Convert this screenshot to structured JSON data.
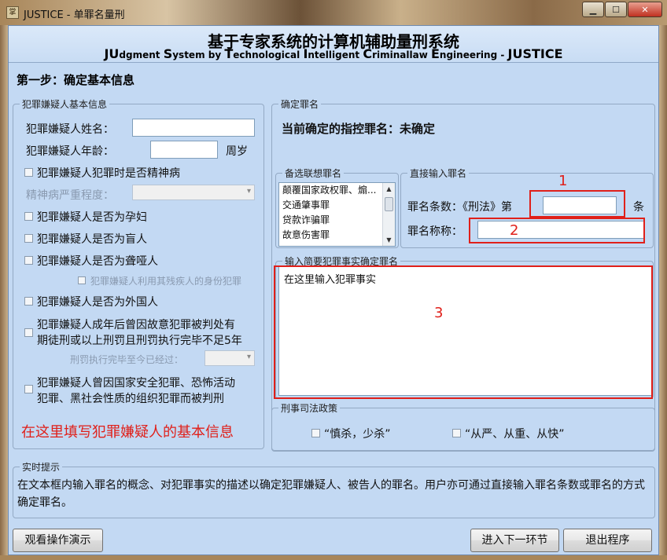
{
  "window": {
    "title": "JUSTICE - 单罪名量刑",
    "app_icon_text": "掌"
  },
  "header": {
    "main_title": "基于专家系统的计算机辅助量刑系统",
    "subtitle_parts": [
      {
        "cap": "JU",
        "rest": "dgment "
      },
      {
        "cap": "S",
        "rest": "ystem by "
      },
      {
        "cap": "T",
        "rest": "echnological "
      },
      {
        "cap": "I",
        "rest": "ntelligent "
      },
      {
        "cap": "C",
        "rest": "riminallaw "
      },
      {
        "cap": "E",
        "rest": "ngineering - "
      },
      {
        "cap": "JUSTICE",
        "rest": ""
      }
    ]
  },
  "step_title": "第一步：确定基本信息",
  "suspect_group": {
    "legend": "犯罪嫌疑人基本信息",
    "name_label": "犯罪嫌疑人姓名：",
    "name_value": "",
    "age_label": "犯罪嫌疑人年龄：",
    "age_value": "",
    "age_unit": "周岁",
    "mental_illness_label": "犯罪嫌疑人犯罪时是否精神病",
    "mental_severity_label": "精神病严重程度：",
    "mental_severity_value": "",
    "pregnant_label": "犯罪嫌疑人是否为孕妇",
    "blind_label": "犯罪嫌疑人是否为盲人",
    "deaf_label": "犯罪嫌疑人是否为聋哑人",
    "disabled_identity_label": "犯罪嫌疑人利用其残疾人的身份犯罪",
    "foreigner_label": "犯罪嫌疑人是否为外国人",
    "recidivist_label_line1": "犯罪嫌疑人成年后曾因故意犯罪被判处有",
    "recidivist_label_line2": "期徒刑或以上刑罚且刑罚执行完毕不足5年",
    "elapsed_label": "刑罚执行完毕至今已经过：",
    "elapsed_value": "",
    "special_label_line1": "犯罪嫌疑人曾因国家安全犯罪、恐怖活动",
    "special_label_line2": "犯罪、黑社会性质的组织犯罪而被判刑",
    "hint": "在这里填写犯罪嫌疑人的基本信息"
  },
  "charge_group": {
    "legend": "确定罪名",
    "current_charge_label": "当前确定的指控罪名：未确定",
    "suggest_legend": "备选联想罪名",
    "suggestions": [
      "颠覆国家政权罪、煽...",
      "交通肇事罪",
      "贷款诈骗罪",
      "故意伤害罪"
    ],
    "direct_legend": "直接输入罪名",
    "article_label": "罪名条数：《刑法》第",
    "article_value": "",
    "article_unit": "条",
    "charge_name_label": "罪名称称：",
    "charge_name_value": "",
    "annotations": [
      "1",
      "2",
      "3"
    ],
    "facts_legend": "输入简要犯罪事实确定罪名",
    "facts_text": "在这里输入犯罪事实"
  },
  "policy_group": {
    "legend": "刑事司法政策",
    "option1": "“慎杀，少杀”",
    "option2": "“从严、从重、从快”"
  },
  "tips_group": {
    "legend": "实时提示",
    "text": "在文本框内输入罪名的概念、对犯罪事实的描述以确定犯罪嫌疑人、被告人的罪名。用户亦可通过直接输入罪名条数或罪名的方式确定罪名。"
  },
  "buttons": {
    "demo": "观看操作演示",
    "next": "进入下一环节",
    "exit": "退出程序"
  },
  "colors": {
    "background": "#c3d9f3",
    "annotation_red": "#e0201a"
  }
}
